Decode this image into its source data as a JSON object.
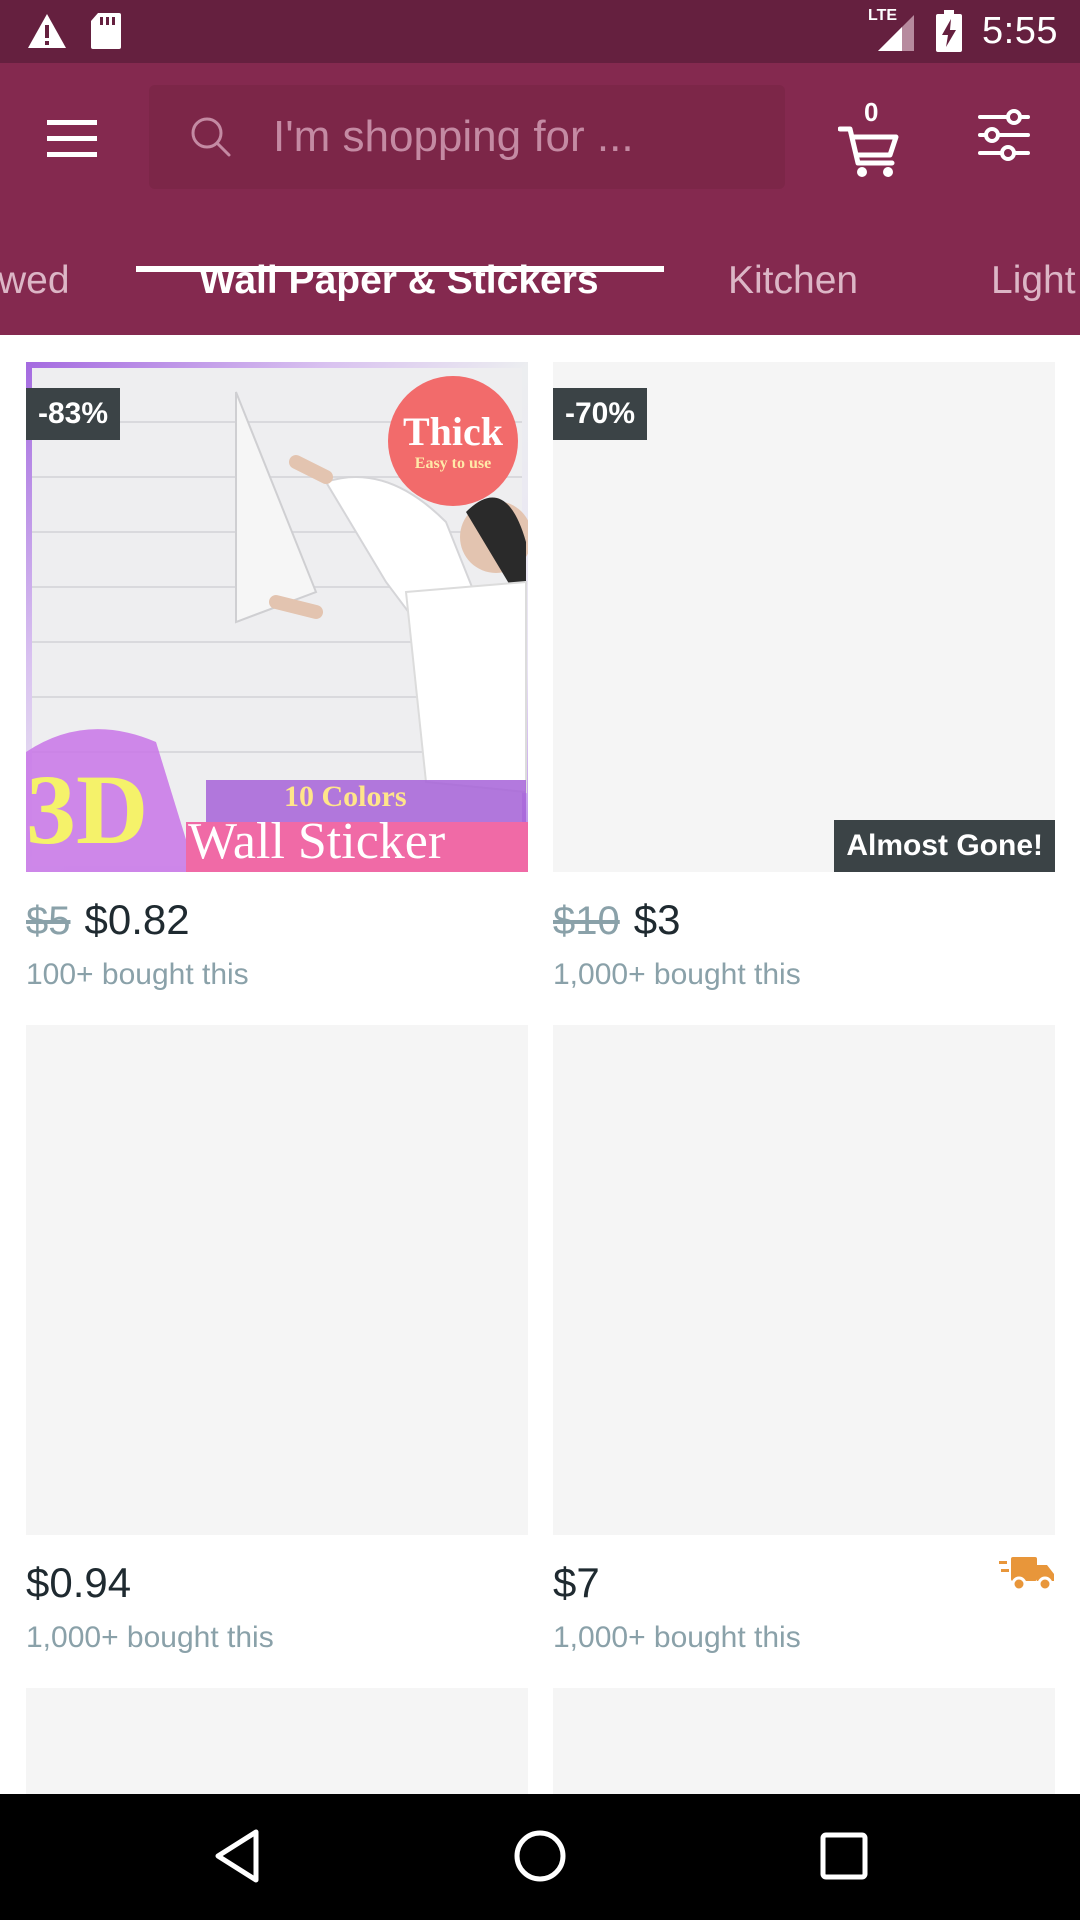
{
  "status_bar": {
    "time": "5:55",
    "network": "LTE",
    "icons": [
      "warning-icon",
      "sd-card-icon",
      "signal-icon",
      "battery-charging-icon"
    ]
  },
  "header": {
    "search_placeholder": "I'm shopping for ...",
    "cart_count": "0",
    "icons": [
      "menu-icon",
      "search-icon",
      "cart-icon",
      "filter-icon"
    ]
  },
  "tabs": [
    {
      "label": "wed"
    },
    {
      "label": "Wall Paper & Stickers",
      "active": true
    },
    {
      "label": "Kitchen"
    },
    {
      "label": "Light"
    }
  ],
  "products": [
    {
      "discount": "-83%",
      "old_price": "$5",
      "price": "$0.82",
      "bought": "100+ bought this",
      "image_text": {
        "badge": "Thick",
        "badge_sub": "Easy to use",
        "big": "3D",
        "colors": "10 Colors",
        "title": "Wall Sticker"
      }
    },
    {
      "discount": "-70%",
      "tag": "Almost Gone!",
      "old_price": "$10",
      "price": "$3",
      "bought": "1,000+ bought this"
    },
    {
      "price": "$0.94",
      "bought": "1,000+ bought this"
    },
    {
      "price": "$7",
      "bought": "1,000+ bought this",
      "icon": "fast-shipping-truck-icon"
    }
  ],
  "colors": {
    "status_bar": "#65203f",
    "app_bar": "#84294f",
    "badge": "#3b4346",
    "truck": "#e8963a"
  }
}
